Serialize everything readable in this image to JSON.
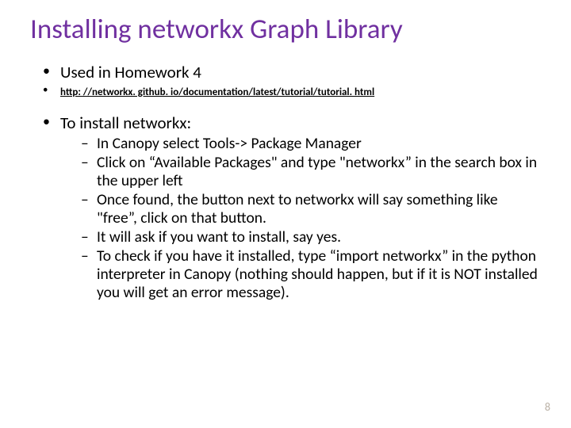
{
  "title": "Installing networkx Graph Library",
  "bullets": {
    "used_in": "Used in Homework 4",
    "url": "http: //networkx. github. io/documentation/latest/tutorial/tutorial. html",
    "install_heading": "To install networkx:",
    "steps": [
      "In Canopy select Tools-> Package Manager",
      "Click on “Available Packages\" and type \"networkx” in the search box in the upper left",
      "Once found, the button next to networkx will say something like \"free”, click on that button.",
      "It will ask if you want to install, say yes.",
      "To check if you have it installed, type “import networkx” in the python interpreter in Canopy (nothing should happen, but if it is NOT installed you will get an error message)."
    ]
  },
  "page_number": "8"
}
